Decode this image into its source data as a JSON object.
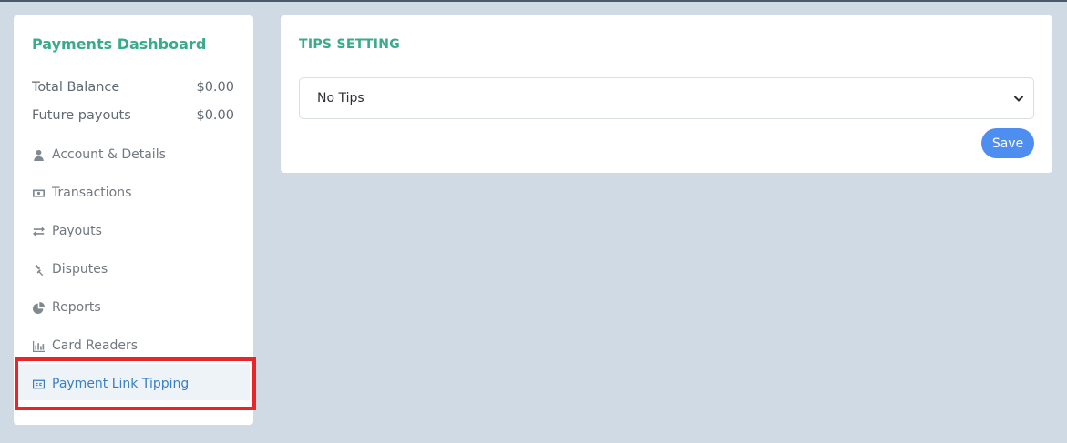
{
  "sidebar": {
    "title": "Payments Dashboard",
    "balances": [
      {
        "label": "Total Balance",
        "value": "$0.00"
      },
      {
        "label": "Future payouts",
        "value": "$0.00"
      }
    ],
    "items": [
      {
        "label": "Account & Details",
        "icon": "user-icon"
      },
      {
        "label": "Transactions",
        "icon": "money-icon"
      },
      {
        "label": "Payouts",
        "icon": "exchange-icon"
      },
      {
        "label": "Disputes",
        "icon": "gavel-icon"
      },
      {
        "label": "Reports",
        "icon": "pie-chart-icon"
      },
      {
        "label": "Card Readers",
        "icon": "bar-chart-icon"
      },
      {
        "label": "Payment Link Tipping",
        "icon": "cc-icon",
        "active": true
      }
    ]
  },
  "tips": {
    "title": "TIPS SETTING",
    "selected_option": "No Tips",
    "save_label": "Save"
  },
  "colors": {
    "accent": "#3aaa8c",
    "primary": "#4d8ef0",
    "active_link": "#3a7fc1",
    "highlight": "#e8262a",
    "background": "#cfdae4"
  }
}
